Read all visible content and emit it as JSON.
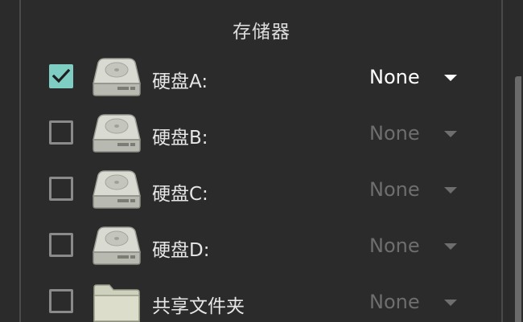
{
  "section": {
    "title": "存储器"
  },
  "rows": [
    {
      "label": "硬盘A:",
      "value": "None",
      "checked": true,
      "enabled": true,
      "icon": "hard-drive-icon"
    },
    {
      "label": "硬盘B:",
      "value": "None",
      "checked": false,
      "enabled": false,
      "icon": "hard-drive-icon"
    },
    {
      "label": "硬盘C:",
      "value": "None",
      "checked": false,
      "enabled": false,
      "icon": "hard-drive-icon"
    },
    {
      "label": "硬盘D:",
      "value": "None",
      "checked": false,
      "enabled": false,
      "icon": "hard-drive-icon"
    },
    {
      "label": "共享文件夹",
      "value": "None",
      "checked": false,
      "enabled": false,
      "icon": "folder-icon"
    }
  ],
  "colors": {
    "background": "#2b2b2b",
    "accent_checkbox": "#7fcec4",
    "text_primary": "#ffffff",
    "text_disabled": "#6e6e6e"
  }
}
